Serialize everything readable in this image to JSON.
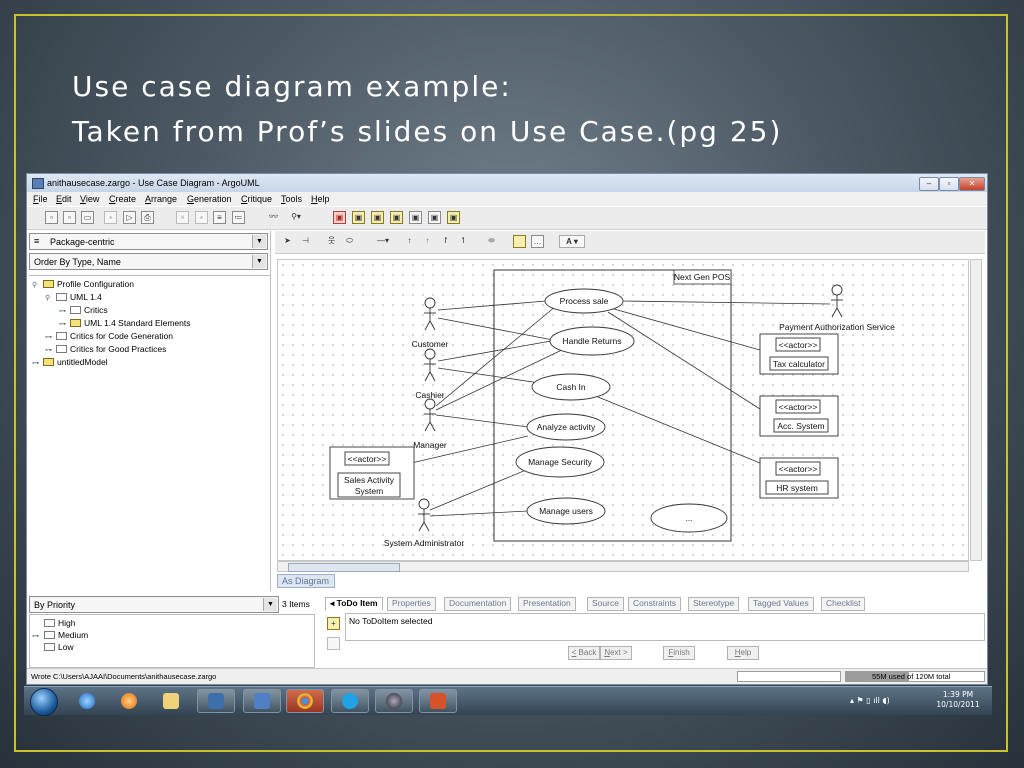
{
  "slide": {
    "title_line1": "Use case diagram example:",
    "title_line2": "Taken from Prof’s slides on Use Case.(pg 25)"
  },
  "window": {
    "title": "anithausecase.zargo - Use Case Diagram - ArgoUML",
    "buttons": {
      "minimize": "–",
      "maximize": "▫",
      "close": "✕"
    }
  },
  "menu": [
    "File",
    "Edit",
    "View",
    "Create",
    "Arrange",
    "Generation",
    "Critique",
    "Tools",
    "Help"
  ],
  "explorer": {
    "perspective": "Package-centric",
    "order": "Order By Type, Name",
    "tree": [
      {
        "label": "Profile Configuration",
        "level": 0
      },
      {
        "label": "UML 1.4",
        "level": 1
      },
      {
        "label": "Critics",
        "level": 2
      },
      {
        "label": "UML 1.4 Standard Elements",
        "level": 2
      },
      {
        "label": "Critics for Code Generation",
        "level": 1
      },
      {
        "label": "Critics for Good Practices",
        "level": 1
      },
      {
        "label": "untitledModel",
        "level": 0
      }
    ]
  },
  "diagram": {
    "system_name": "Next Gen POS",
    "actors": {
      "customer": "Customer",
      "cashier": "Cashier",
      "manager": "Manager",
      "system_admin": "System Administrator",
      "payment_service": "Payment Authorization Service"
    },
    "use_cases": {
      "process_sale": "Process sale",
      "handle_returns": "Handle Returns",
      "cash_in": "Cash In",
      "analyze_activity": "Analyze activity",
      "manage_security": "Manage Security",
      "manage_users": "Manage users",
      "unnamed": "..."
    },
    "actor_boxes": {
      "stereotype": "<<actor>>",
      "sales_activity": "Sales Activity System",
      "tax": "Tax calculator",
      "acc": "Acc. System",
      "hr": "HR system"
    },
    "tab_label": "As Diagram"
  },
  "todo": {
    "sort": "By Priority",
    "count": "3 Items",
    "priorities": [
      "High",
      "Medium",
      "Low"
    ]
  },
  "details": {
    "tabs": [
      "◂ ToDo Item",
      "Properties",
      "Documentation",
      "Presentation",
      "Source",
      "Constraints",
      "Stereotype",
      "Tagged Values",
      "Checklist"
    ],
    "message": "No ToDoItem selected",
    "wizard_buttons": {
      "back": "< Back",
      "next": "Next >",
      "finish": "Finish",
      "help": "Help"
    }
  },
  "status": {
    "message": "Wrote C:\\Users\\AJAAI\\Documents\\anithausecase.zargo",
    "memory_used": "55M used",
    "memory_total": " of 120M total",
    "memory_fraction": 0.46
  },
  "taskbar": {
    "time": "1:39 PM",
    "date": "10/10/2011"
  },
  "colors": {
    "accent_border": "#c9c12e",
    "window_title": "#c6d5e8"
  }
}
